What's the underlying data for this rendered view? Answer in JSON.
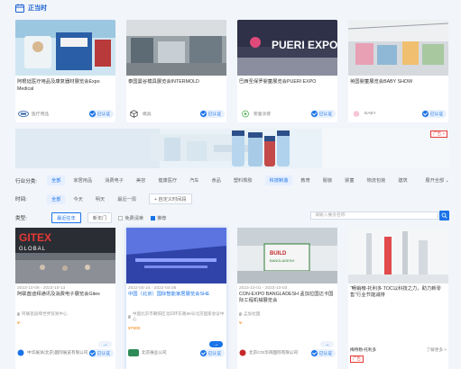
{
  "header": {
    "title": "正当时"
  },
  "top_cards": [
    {
      "title": "阿根廷医疗用品及康复器材展览会Expo Medical",
      "category": "医疗用品",
      "badge": "已认证"
    },
    {
      "title": "泰国曼谷模具展览会INTERMOLD",
      "category": "模具",
      "badge": "已认证"
    },
    {
      "title": "巴西圣保罗婴童展览会PUERI EXPO",
      "category": "婴童孕婴",
      "badge": "已认证"
    },
    {
      "title": "英国婴童展览会BABY SHOW",
      "category": "BABY",
      "badge": "已认证"
    }
  ],
  "banner": {
    "ad": "广告 ×"
  },
  "filters": {
    "industry_label": "行业分类:",
    "industries": [
      "全部",
      "家居用品",
      "消费电子",
      "美容",
      "健康医疗",
      "汽车",
      "食品",
      "塑料橡胶",
      "科技制造",
      "教育",
      "服装",
      "婴童",
      "物流包装",
      "建筑",
      "展开全部"
    ],
    "industry_selected": "科技制造",
    "time_label": "时间:",
    "times": [
      "全部",
      "今天",
      "明天",
      "最近一周"
    ],
    "time_custom": "+ 自定义时间段",
    "type_label": "类型:",
    "types": [
      "最近往年",
      "新年门"
    ],
    "checks": [
      "免费请柬",
      "推荐"
    ],
    "search_placeholder": "请输入展会名称"
  },
  "expos": [
    {
      "date": "2023-10-09 - 2023-10-13",
      "title": "阿联酋迪拜通讯及消费电子展览会Gitex",
      "location": "阿联酋迪拜世界贸易中心",
      "price": "¥-",
      "org": "中华展洋(北京)国际展览有限公司",
      "badge": "已认证"
    },
    {
      "date": "2022-04-24 - 2022-04-26",
      "title": "中国（北京）国际智能家居展览会SHE",
      "location": "中国北京市朝阳区北四环东路88号北京国家会议中心",
      "price": "¥7600",
      "org": "北京展业公司",
      "badge": "已认证"
    },
    {
      "date": "2023-10-01 - 2023-10-03",
      "title": "CON-EXPO BANGLADESH 孟加拉国达卡国际工程机械展览会",
      "location": "孟加拉国",
      "price": "¥-",
      "org": "北京CGI华商国际有限公司",
      "badge": "已认证"
    },
    {
      "date": "",
      "title": "“畅销榜-托利多 TOC以科技之力，助力新零售”行业节能减排",
      "location": "",
      "price": "",
      "org": "梅特勒-托利多",
      "badge": "广告",
      "more": "了解更多 >"
    }
  ],
  "colors": {
    "accent": "#1a73e8",
    "price": "#f57c00",
    "ad": "#e53935"
  }
}
